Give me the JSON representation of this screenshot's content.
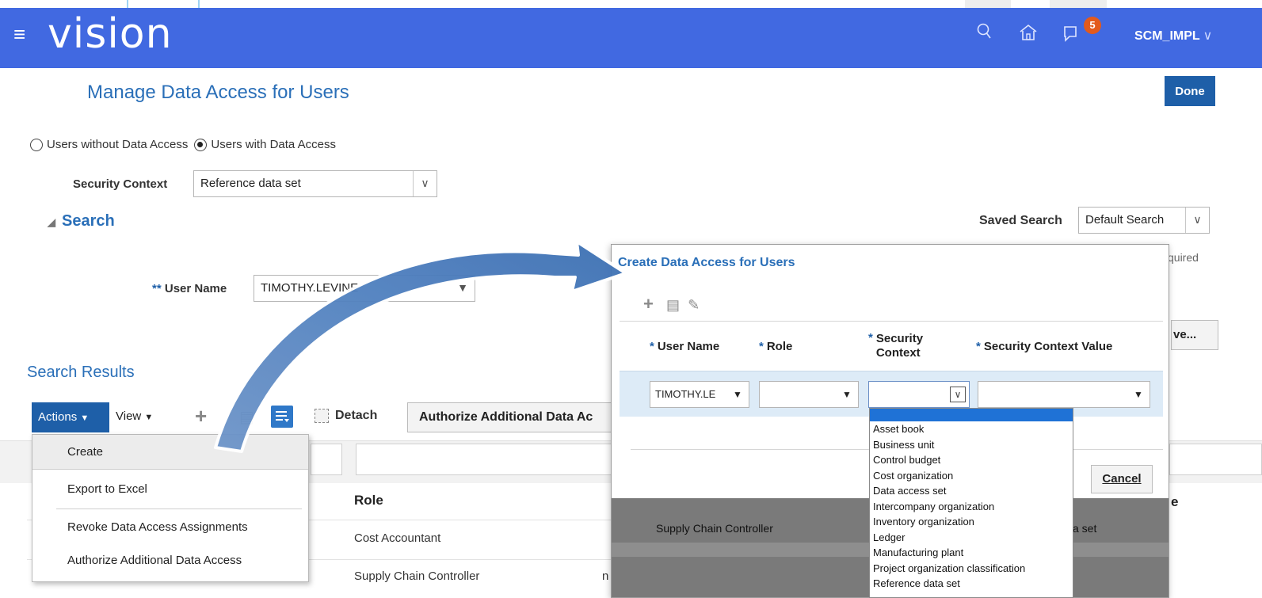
{
  "header": {
    "logo": "vision",
    "notifications_count": "5",
    "user": "SCM_IMPL"
  },
  "page": {
    "title": "Manage Data Access for Users",
    "done_label": "Done",
    "radio_without": "Users without Data Access",
    "radio_with": "Users with Data Access",
    "security_context_label": "Security Context",
    "security_context_value": "Reference data set",
    "search_header": "Search",
    "saved_search_label": "Saved Search",
    "saved_search_value": "Default Search",
    "required_note": "quired",
    "user_name_label": "User Name",
    "user_name_value": "TIMOTHY.LEVINE",
    "advanced_button": "ve..."
  },
  "results": {
    "title": "Search Results",
    "actions_label": "Actions",
    "view_label": "View",
    "detach_label": "Detach",
    "authorize_label": "Authorize Additional Data Ac",
    "role_header": "Role",
    "trailing_header": "e",
    "rows": [
      {
        "role": "Cost Accountant"
      },
      {
        "role": "Supply Chain Controller"
      }
    ],
    "row2_partial": "n  8"
  },
  "actions_menu": {
    "items": [
      "Create",
      "Export to Excel",
      "Revoke Data Access Assignments",
      "Authorize Additional Data Access"
    ]
  },
  "dialog": {
    "title": "Create Data Access for Users",
    "columns": {
      "user_name": "User Name",
      "role": "Role",
      "security_context": "Security Context",
      "security_context_value": "Security Context Value"
    },
    "row": {
      "user_name": "TIMOTHY.LE",
      "role": "",
      "security_context": "",
      "security_context_value": ""
    },
    "ok_partial": "e",
    "cancel_label": "Cancel",
    "behind_role": "Supply Chain Controller",
    "behind_suffix": "a set"
  },
  "security_context_options": [
    "Asset book",
    "Business unit",
    "Control budget",
    "Cost organization",
    "Data access set",
    "Intercompany organization",
    "Inventory organization",
    "Ledger",
    "Manufacturing plant",
    "Project organization classification",
    "Reference data set"
  ],
  "colors": {
    "header_bg": "#4169e1",
    "primary_button": "#1e5fa8",
    "title_blue": "#2a6fb8",
    "badge": "#e35a1c",
    "dropdown_highlight": "#1f72d6"
  },
  "icons": [
    "hamburger-icon",
    "search-icon",
    "home-icon",
    "notifications-icon",
    "chevron-down-icon",
    "add-icon",
    "columns-icon",
    "edit-icon",
    "filter-icon",
    "detach-icon",
    "callout-arrow"
  ]
}
